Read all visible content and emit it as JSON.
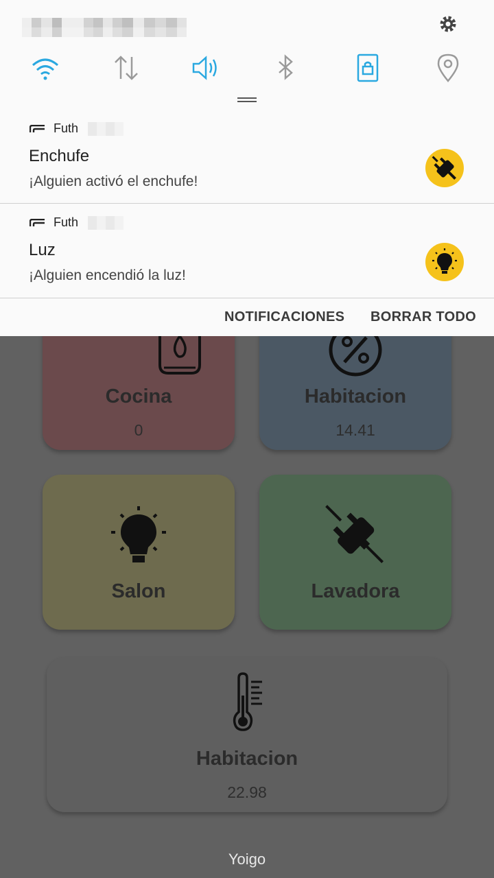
{
  "status": {
    "settings_icon": "gear-icon"
  },
  "quick_settings": [
    {
      "name": "wifi-icon",
      "active": true
    },
    {
      "name": "data-icon",
      "active": false
    },
    {
      "name": "sound-icon",
      "active": true
    },
    {
      "name": "bluetooth-icon",
      "active": false
    },
    {
      "name": "rotation-lock-icon",
      "active": true
    },
    {
      "name": "location-icon",
      "active": false
    }
  ],
  "notifications": [
    {
      "app": "Futh",
      "title": "Enchufe",
      "message": "¡Alguien activó el enchufe!",
      "icon": "plug-icon"
    },
    {
      "app": "Futh",
      "title": "Luz",
      "message": "¡Alguien encendió la luz!",
      "icon": "bulb-icon"
    }
  ],
  "actions": {
    "notifications": "NOTIFICACIONES",
    "clear_all": "BORRAR TODO"
  },
  "cards": [
    {
      "name": "Cocina",
      "value": "0",
      "icon": "gas-icon",
      "color": "#6b4a4c"
    },
    {
      "name": "Habitacion",
      "value": "14.41",
      "icon": "percent-icon",
      "color": "#4b5864"
    },
    {
      "name": "Salon",
      "value": "",
      "icon": "bulb-icon",
      "color": "#6e6b4e"
    },
    {
      "name": "Lavadora",
      "value": "",
      "icon": "plug-icon",
      "color": "#4d6650"
    },
    {
      "name": "Habitacion",
      "value": "22.98",
      "icon": "thermometer-icon",
      "color": "#5f5f5f"
    }
  ],
  "carrier": "Yoigo",
  "colors": {
    "accent": "#2aa8e0",
    "badge": "#f5c21b"
  }
}
